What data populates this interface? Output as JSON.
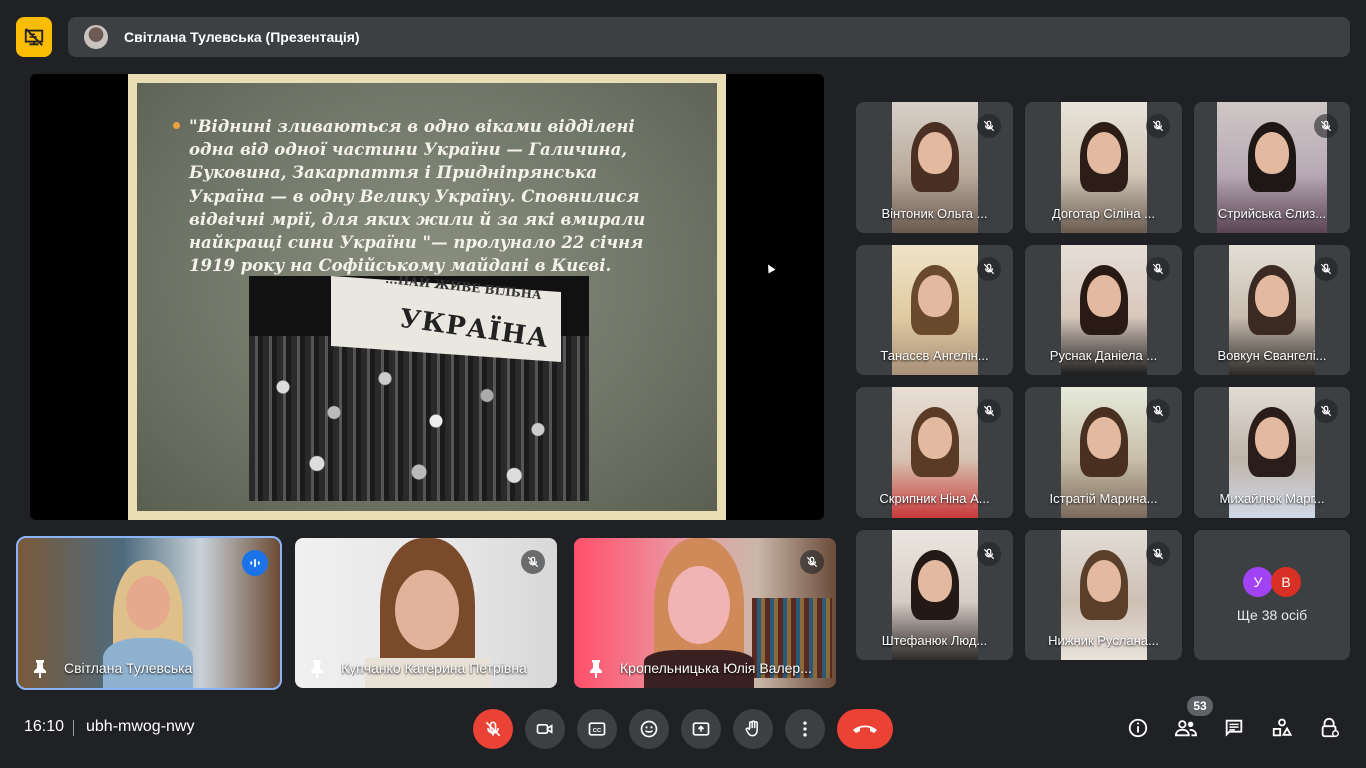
{
  "header": {
    "presenter_title": "Світлана Тулевська (Презентація)"
  },
  "slide": {
    "text": "\"Віднині зливаються в одно віками відділені одна від одної частини України — Галичина, Буковина, Закарпаття і Придніпрянська Україна — в одну Велику Україну. Сповнилися відвічні мрії, для яких жили й за які вмирали найкращі сини України \"— пролунало 22 січня 1919 року на Софійському майдані в Києві.",
    "photo_banner_top": "...НАЙ ЖИВЕ ВІЛЬНА",
    "photo_banner": "УКРАЇНА"
  },
  "participants": [
    {
      "name": "Вінтоник Ольга ...",
      "muted": true
    },
    {
      "name": "Доготар Сіліна ...",
      "muted": true
    },
    {
      "name": "Стрийська Єлиз...",
      "muted": true
    },
    {
      "name": "Танасєв Ангелін...",
      "muted": true
    },
    {
      "name": "Руснак Даніела ...",
      "muted": true
    },
    {
      "name": "Вовкун Євангелі...",
      "muted": true
    },
    {
      "name": "Скрипник Ніна А...",
      "muted": true
    },
    {
      "name": "Істратій Марина...",
      "muted": true
    },
    {
      "name": "Михайлюк Марг...",
      "muted": true
    },
    {
      "name": "Штефанюк Люд...",
      "muted": true
    },
    {
      "name": "Нижник Руслана...",
      "muted": true
    }
  ],
  "more_tile": {
    "avatars": [
      {
        "letter": "У",
        "color": "#a142f4"
      },
      {
        "letter": "В",
        "color": "#d93025"
      }
    ],
    "text": "Ще 38 осіб"
  },
  "featured": [
    {
      "name": "Світлана Тулевська",
      "speaking": true
    },
    {
      "name": "Купчанко Катерина Петрівна",
      "muted": true
    },
    {
      "name": "Кропельницька Юлія Валер...",
      "muted": true
    }
  ],
  "footer": {
    "time": "16:10",
    "meeting_code": "ubh-mwog-nwy",
    "participants_count": "53"
  },
  "colors": {
    "background": "#202124",
    "tile": "#3c4043",
    "accent_blue": "#1a73e8",
    "danger_red": "#ea4335",
    "presenting_yellow": "#fbbc04"
  },
  "icons": [
    "presentation-off-icon",
    "mic-off-icon",
    "camera-icon",
    "captions-icon",
    "emoji-icon",
    "present-icon",
    "raise-hand-icon",
    "more-options-icon",
    "hang-up-icon",
    "info-icon",
    "people-icon",
    "chat-icon",
    "activities-icon",
    "host-controls-icon",
    "pin-icon",
    "speaking-icon"
  ]
}
